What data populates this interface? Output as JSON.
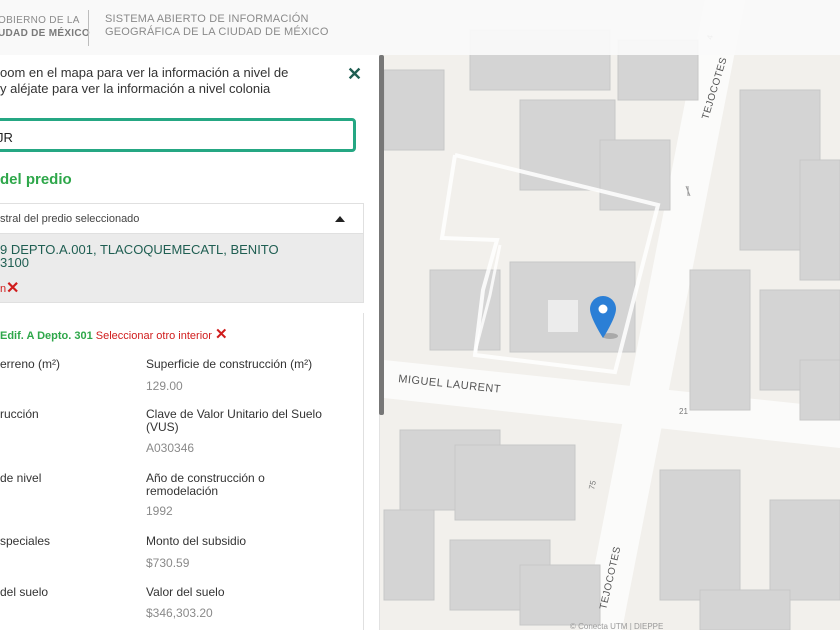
{
  "header": {
    "logo_line1": "OBIERNO DE LA",
    "logo_line2": "UDAD DE MÉXICO",
    "system_line1": "SISTEMA ABIERTO DE INFORMACIÓN",
    "system_line2": "GEOGRÁFICA DE LA CIUDAD DE MÉXICO"
  },
  "panel": {
    "hint_line1": "oom en el mapa para ver la información a nivel de",
    "hint_line2": "y aléjate para ver la información a nivel colonia",
    "close_icon": "close-icon",
    "search_value": "JR",
    "section_title": "del predio",
    "card_header": "stral del predio seleccionado",
    "address_line1": "9 DEPTO.A.001, TLACOQUEMECATL, BENITO",
    "address_line2": "3100",
    "delete_label": "n",
    "interior_selected": "Edif. A Depto. 301",
    "interior_change": "Seleccionar otro interior"
  },
  "fields": {
    "left": [
      {
        "label": "erreno (m²)",
        "value": ""
      },
      {
        "label": "rucción",
        "value": ""
      },
      {
        "label": "de nivel",
        "value": ""
      },
      {
        "label": "speciales",
        "value": ""
      },
      {
        "label": "del suelo",
        "value": ""
      }
    ],
    "right": [
      {
        "label": "Superficie de construcción (m²)",
        "value": "129.00"
      },
      {
        "label": "Clave de Valor Unitario del Suelo (VUS)",
        "value": "A030346"
      },
      {
        "label": "Año de construcción o remodelación",
        "value": "1992"
      },
      {
        "label": "Monto del subsidio",
        "value": "$730.59"
      },
      {
        "label": "Valor del suelo",
        "value": "$346,303.20"
      }
    ]
  },
  "map": {
    "street_1": "MIGUEL LAURENT",
    "street_2": "TEJOCOTES",
    "street_2b": "TEJOCOTES",
    "num_1": "21",
    "num_2": "75",
    "num_3": "4",
    "footer": "© Conecta UTM | DIEPPE"
  },
  "colors": {
    "accent": "#25a783",
    "title_green": "#2ea74a",
    "danger": "#d01c1c",
    "pin": "#2b7fd6"
  }
}
